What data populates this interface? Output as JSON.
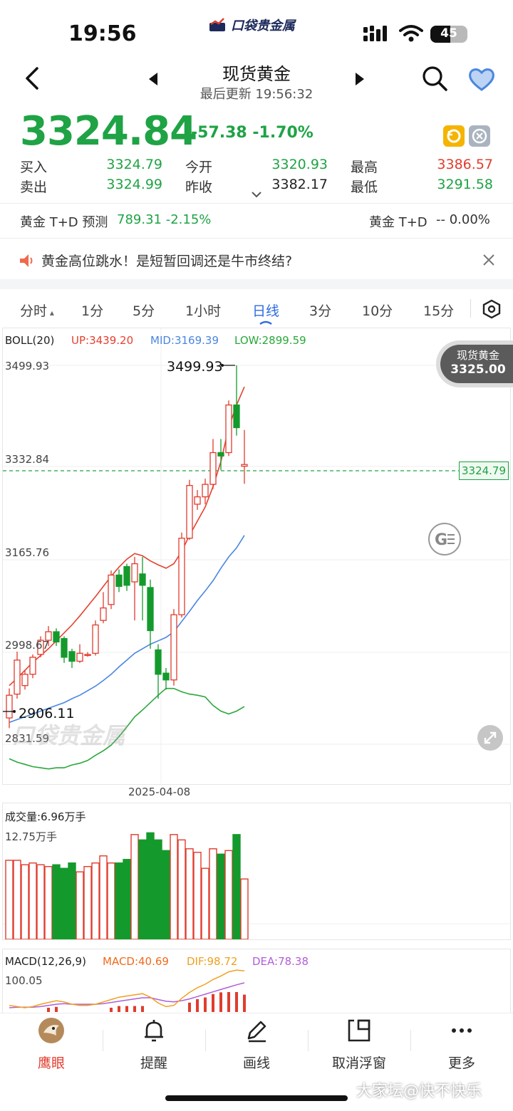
{
  "status_bar": {
    "time": "19:56",
    "battery": "45"
  },
  "brand": {
    "name": "口袋贵金属"
  },
  "header": {
    "title": "现货黄金",
    "subtitle": "最后更新 19:56:32"
  },
  "quote": {
    "price": "3324.84",
    "change": "-57.38 -1.70%",
    "rows": [
      {
        "l1": "买入",
        "v1": "3324.79",
        "l2": "今开",
        "v2": "3320.93",
        "l3": "最高",
        "v3": "3386.57"
      },
      {
        "l1": "卖出",
        "v1": "3324.99",
        "l2": "昨收",
        "v2": "3382.17",
        "l3": "最低",
        "v3": "3291.58"
      }
    ]
  },
  "td": {
    "left_label": "黄金 T+D 预测",
    "left_value": "789.31 -2.15%",
    "right_label": "黄金 T+D",
    "right_value": "-- 0.00%"
  },
  "news": {
    "text": "黄金高位跳水！是短暂回调还是牛市终结?"
  },
  "tabs": [
    "分时",
    "1分",
    "5分",
    "1小时",
    "日线",
    "3分",
    "10分",
    "15分"
  ],
  "active_tab": "日线",
  "boll": {
    "name": "BOLL(20)",
    "up": "UP:3439.20",
    "mid": "MID:3169.39",
    "low": "LOW:2899.59"
  },
  "price_tag": {
    "name": "现货黄金",
    "value": "3325.00"
  },
  "current_price_box": "3324.79",
  "chart_data": {
    "type": "candlestick",
    "y_ticks": [
      "3499.93",
      "3332.84",
      "3165.76",
      "2998.67",
      "2831.59"
    ],
    "x_tick": "2025-04-08",
    "high_annotation": "3499.93",
    "low_annotation": "2906.11",
    "ylim": [
      2831.59,
      3499.93
    ],
    "candles": [
      {
        "o": 2878,
        "c": 2918,
        "h": 2930,
        "l": 2860
      },
      {
        "o": 2920,
        "c": 2980,
        "h": 2995,
        "l": 2912
      },
      {
        "o": 2935,
        "c": 2955,
        "h": 2962,
        "l": 2928
      },
      {
        "o": 2955,
        "c": 2985,
        "h": 2990,
        "l": 2948
      },
      {
        "o": 2990,
        "c": 3015,
        "h": 3022,
        "l": 2985
      },
      {
        "o": 3015,
        "c": 3030,
        "h": 3040,
        "l": 3005
      },
      {
        "o": 3030,
        "c": 3012,
        "h": 3036,
        "l": 3005
      },
      {
        "o": 3018,
        "c": 2985,
        "h": 3022,
        "l": 2975
      },
      {
        "o": 2995,
        "c": 2978,
        "h": 3000,
        "l": 2966
      },
      {
        "o": 2978,
        "c": 2992,
        "h": 3008,
        "l": 2975
      },
      {
        "o": 2990,
        "c": 2990,
        "h": 2994,
        "l": 2986
      },
      {
        "o": 2992,
        "c": 3042,
        "h": 3050,
        "l": 2988
      },
      {
        "o": 3050,
        "c": 3072,
        "h": 3100,
        "l": 3045
      },
      {
        "o": 3078,
        "c": 3130,
        "h": 3138,
        "l": 3070
      },
      {
        "o": 3130,
        "c": 3110,
        "h": 3140,
        "l": 3100
      },
      {
        "o": 3145,
        "c": 3112,
        "h": 3150,
        "l": 3102
      },
      {
        "o": 3118,
        "c": 3150,
        "h": 3162,
        "l": 3050
      },
      {
        "o": 3132,
        "c": 3112,
        "h": 3162,
        "l": 3050
      },
      {
        "o": 3108,
        "c": 3032,
        "h": 3122,
        "l": 3000
      },
      {
        "o": 2998,
        "c": 2955,
        "h": 3008,
        "l": 2912
      },
      {
        "o": 2957,
        "c": 2945,
        "h": 2966,
        "l": 2928
      },
      {
        "o": 2945,
        "c": 3060,
        "h": 3070,
        "l": 2935
      },
      {
        "o": 3060,
        "c": 3195,
        "h": 3205,
        "l": 3055
      },
      {
        "o": 3195,
        "c": 3288,
        "h": 3298,
        "l": 3192
      },
      {
        "o": 3255,
        "c": 3268,
        "h": 3280,
        "l": 3245
      },
      {
        "o": 3268,
        "c": 3290,
        "h": 3300,
        "l": 3255
      },
      {
        "o": 3290,
        "c": 3346,
        "h": 3370,
        "l": 3282
      },
      {
        "o": 3346,
        "c": 3340,
        "h": 3370,
        "l": 3315
      },
      {
        "o": 3346,
        "c": 3430,
        "h": 3438,
        "l": 3340
      },
      {
        "o": 3430,
        "c": 3390,
        "h": 3499.93,
        "l": 3376
      },
      {
        "o": 3322,
        "c": 3325,
        "h": 3386,
        "l": 3291
      }
    ],
    "boll_up": [
      2935,
      2948,
      2962,
      2976,
      2988,
      3000,
      3014,
      3028,
      3042,
      3058,
      3075,
      3092,
      3110,
      3128,
      3144,
      3158,
      3168,
      3164,
      3155,
      3148,
      3142,
      3150,
      3172,
      3200,
      3225,
      3250,
      3286,
      3330,
      3390,
      3430,
      3462
    ],
    "boll_mid": [
      2870,
      2875,
      2880,
      2885,
      2890,
      2895,
      2900,
      2905,
      2912,
      2918,
      2926,
      2934,
      2944,
      2955,
      2968,
      2980,
      2992,
      3000,
      3008,
      3014,
      3020,
      3030,
      3048,
      3066,
      3085,
      3102,
      3120,
      3142,
      3162,
      3178,
      3200
    ],
    "boll_low": [
      2806,
      2800,
      2796,
      2792,
      2790,
      2788,
      2790,
      2790,
      2795,
      2798,
      2803,
      2812,
      2820,
      2830,
      2845,
      2862,
      2880,
      2892,
      2905,
      2918,
      2930,
      2930,
      2924,
      2920,
      2918,
      2915,
      2900,
      2890,
      2885,
      2890,
      2898
    ],
    "volume_label": "成交量:6.96万手",
    "volume_max_label": "12.75万手",
    "volume": [
      8.9,
      8.9,
      8.4,
      8.6,
      8.4,
      8.2,
      8.4,
      8.0,
      8.6,
      7.6,
      8.2,
      8.6,
      9.4,
      8.6,
      8.6,
      9.0,
      11.8,
      11.2,
      12.0,
      11.2,
      10.0,
      11.8,
      11.2,
      10.2,
      9.8,
      8.0,
      10.2,
      9.6,
      10.0,
      11.8,
      6.8
    ],
    "macd_label": "MACD(12,26,9)",
    "macd_values": {
      "macd": "MACD:40.69",
      "dif": "DIF:98.72",
      "dea": "DEA:78.38"
    },
    "macd_top_label": "100.05",
    "dif": [
      40,
      38,
      36,
      38,
      42,
      45,
      48,
      46,
      42,
      40,
      40,
      42,
      46,
      50,
      54,
      56,
      58,
      60,
      54,
      44,
      38,
      40,
      52,
      62,
      70,
      76,
      84,
      90,
      97,
      100,
      98.72
    ],
    "dea": [
      36,
      37,
      37,
      37,
      38,
      40,
      42,
      43,
      42,
      42,
      42,
      42,
      43,
      45,
      47,
      49,
      51,
      53,
      53,
      50,
      47,
      46,
      48,
      51,
      55,
      59,
      63,
      67,
      71,
      75,
      78.38
    ],
    "colors": {
      "up": "#e03c2e",
      "down": "#149a2c",
      "boll_up": "#e4412f",
      "boll_mid": "#4a86e0",
      "boll_low": "#2aa83a",
      "dif": "#f0a020",
      "dea": "#b05ed8",
      "current": "#1fa345"
    }
  },
  "watermark": "口袋贵金属",
  "bottom_nav": [
    {
      "label": "鹰眼",
      "icon": "eagle-eye-icon"
    },
    {
      "label": "提醒",
      "icon": "bell-icon"
    },
    {
      "label": "画线",
      "icon": "pen-icon"
    },
    {
      "label": "取消浮窗",
      "icon": "float-window-icon"
    },
    {
      "label": "更多",
      "icon": "more-icon"
    }
  ],
  "footer_watermark": "大家坛@快不快乐"
}
